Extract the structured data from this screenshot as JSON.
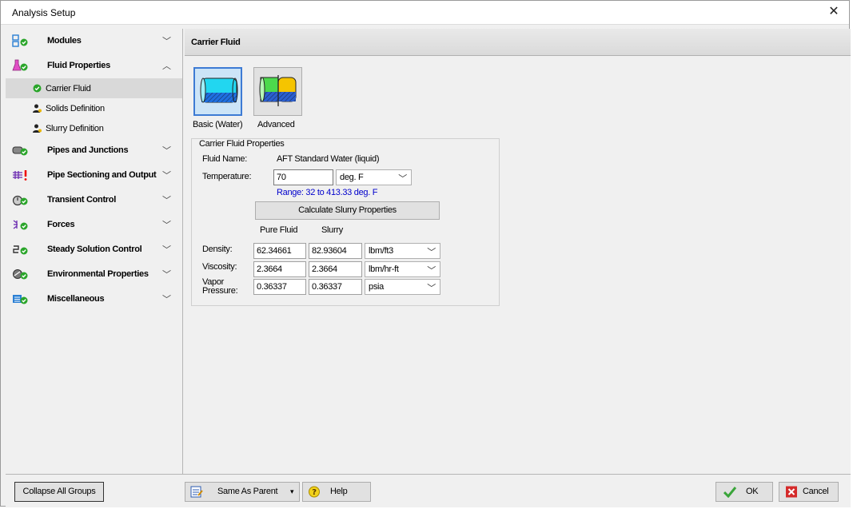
{
  "window": {
    "title": "Analysis Setup",
    "close_glyph": "✕"
  },
  "sidebar": {
    "groups": [
      {
        "label": "Modules",
        "icon": "modules-icon",
        "chevron": "﹀"
      },
      {
        "label": "Fluid Properties",
        "icon": "flask-icon",
        "chevron": "︿",
        "items": [
          {
            "label": "Carrier Fluid",
            "icon": "green-check-icon",
            "selected": true
          },
          {
            "label": "Solids Definition",
            "icon": "person-icon"
          },
          {
            "label": "Slurry Definition",
            "icon": "person-icon"
          }
        ]
      },
      {
        "label": "Pipes and Junctions",
        "icon": "pipe-icon",
        "chevron": "﹀"
      },
      {
        "label": "Pipe Sectioning and Output",
        "icon": "sectioning-icon",
        "chevron": "﹀"
      },
      {
        "label": "Transient Control",
        "icon": "stopwatch-icon",
        "chevron": "﹀"
      },
      {
        "label": "Forces",
        "icon": "forces-icon",
        "chevron": "﹀"
      },
      {
        "label": "Steady Solution Control",
        "icon": "solution-icon",
        "chevron": "﹀"
      },
      {
        "label": "Environmental Properties",
        "icon": "environment-icon",
        "chevron": "﹀"
      },
      {
        "label": "Miscellaneous",
        "icon": "misc-icon",
        "chevron": "﹀"
      }
    ]
  },
  "main": {
    "header_title": "Carrier Fluid",
    "fluid_buttons": [
      {
        "label": "Basic (Water)",
        "active": true
      },
      {
        "label": "Advanced",
        "active": false
      }
    ],
    "props": {
      "legend": "Carrier Fluid Properties",
      "fluid_name_label": "Fluid Name:",
      "fluid_name_value": "AFT Standard Water (liquid)",
      "temperature_label": "Temperature:",
      "temperature_value": "70",
      "temperature_unit": "deg. F",
      "range_text": "Range: 32 to 413.33 deg. F",
      "calc_button": "Calculate Slurry Properties",
      "col_pure": "Pure Fluid",
      "col_slurry": "Slurry",
      "rows": [
        {
          "label": "Density:",
          "pure": "62.34661",
          "slurry": "82.93604",
          "unit": "lbm/ft3"
        },
        {
          "label": "Viscosity:",
          "pure": "2.3664",
          "slurry": "2.3664",
          "unit": "lbm/hr-ft"
        },
        {
          "label": "Vapor Pressure:",
          "pure": "0.36337",
          "slurry": "0.36337",
          "unit": "psia"
        }
      ]
    }
  },
  "bottom": {
    "collapse": "Collapse All Groups",
    "same_as_parent": "Same As Parent",
    "help": "Help",
    "ok": "OK",
    "cancel": "Cancel"
  },
  "colors": {
    "accent": "#3d7bd4",
    "range_text": "#0000cc",
    "selected_row": "#d9d9d9"
  }
}
